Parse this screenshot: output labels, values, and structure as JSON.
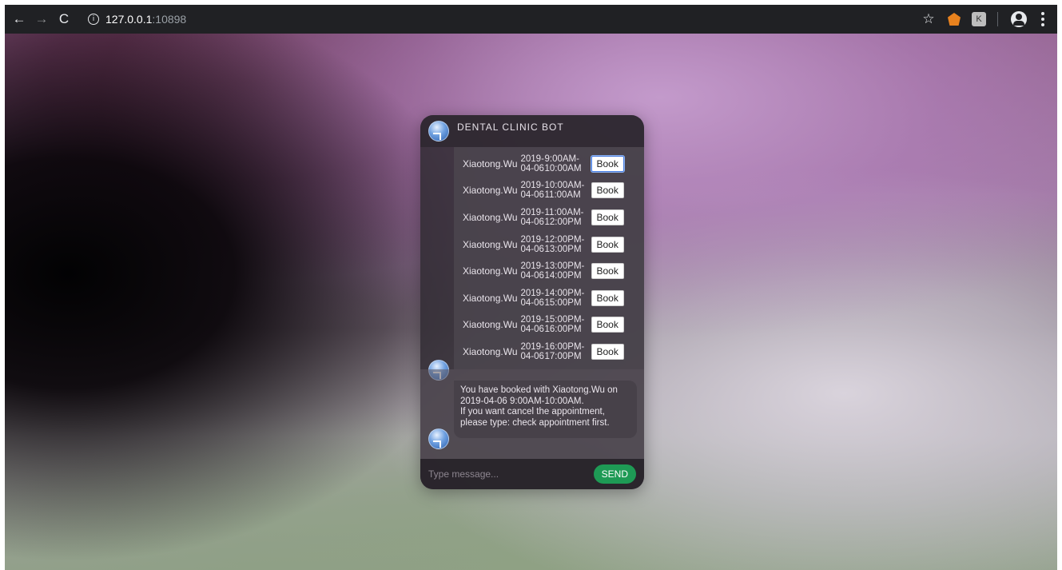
{
  "browser": {
    "url_host": "127.0.0.1",
    "url_port": ":10898",
    "icons": {
      "back": "←",
      "forward": "→",
      "reload": "C",
      "info": "i",
      "star": "☆",
      "ext_k": "K"
    }
  },
  "chat": {
    "title": "DENTAL CLINIC BOT",
    "slots": [
      {
        "doctor": "Xiaotong.Wu",
        "date_line1": "2019-",
        "date_line2": "04-06",
        "time_line1": "9:00AM-",
        "time_line2": "10:00AM",
        "button": "Book"
      },
      {
        "doctor": "Xiaotong.Wu",
        "date_line1": "2019-",
        "date_line2": "04-06",
        "time_line1": "10:00AM-",
        "time_line2": "11:00AM",
        "button": "Book"
      },
      {
        "doctor": "Xiaotong.Wu",
        "date_line1": "2019-",
        "date_line2": "04-06",
        "time_line1": "11:00AM-",
        "time_line2": "12:00PM",
        "button": "Book"
      },
      {
        "doctor": "Xiaotong.Wu",
        "date_line1": "2019-",
        "date_line2": "04-06",
        "time_line1": "12:00PM-",
        "time_line2": "13:00PM",
        "button": "Book"
      },
      {
        "doctor": "Xiaotong.Wu",
        "date_line1": "2019-",
        "date_line2": "04-06",
        "time_line1": "13:00PM-",
        "time_line2": "14:00PM",
        "button": "Book"
      },
      {
        "doctor": "Xiaotong.Wu",
        "date_line1": "2019-",
        "date_line2": "04-06",
        "time_line1": "14:00PM-",
        "time_line2": "15:00PM",
        "button": "Book"
      },
      {
        "doctor": "Xiaotong.Wu",
        "date_line1": "2019-",
        "date_line2": "04-06",
        "time_line1": "15:00PM-",
        "time_line2": "16:00PM",
        "button": "Book"
      },
      {
        "doctor": "Xiaotong.Wu",
        "date_line1": "2019-",
        "date_line2": "04-06",
        "time_line1": "16:00PM-",
        "time_line2": "17:00PM",
        "button": "Book"
      }
    ],
    "reply_lines": [
      "You have booked with Xiaotong.Wu on",
      "2019-04-06 9:00AM-10:00AM.",
      "If you want cancel the appointment,",
      "please type: check appointment first."
    ],
    "input_placeholder": "Type message...",
    "send_label": "SEND"
  },
  "colors": {
    "send_button": "#1e9a55",
    "browser_bar": "#202124"
  }
}
